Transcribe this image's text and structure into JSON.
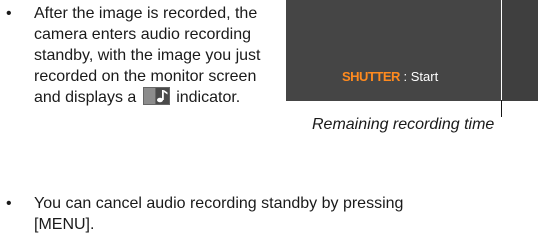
{
  "bullet1": {
    "marker": "•",
    "text_before": "After the image is recorded, the camera enters audio recording standby, with the image you just recorded on the monitor screen and displays a",
    "icon": "audio-snapshot-icon",
    "text_after": " indicator."
  },
  "screen": {
    "shutter_key": "SHUTTER",
    "shutter_action": " : Start"
  },
  "caption": "Remaining recording time",
  "bullet2": {
    "marker": "•",
    "line1": "You can cancel audio recording standby by pressing",
    "line2": "[MENU]."
  }
}
